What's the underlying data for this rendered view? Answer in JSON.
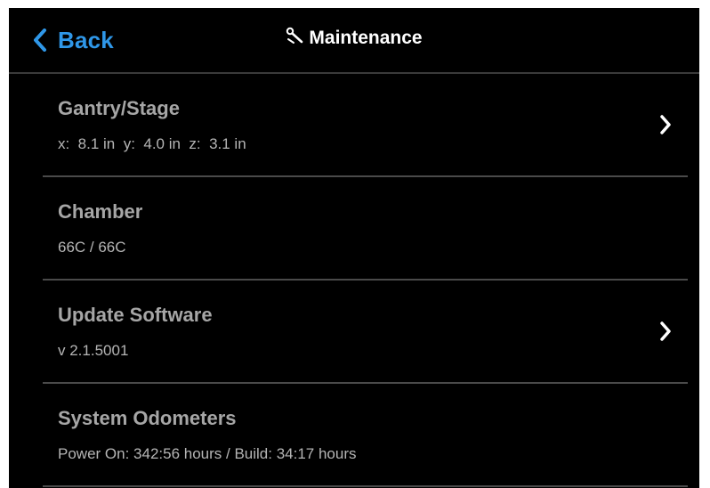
{
  "header": {
    "back_label": "Back",
    "title": "Maintenance",
    "title_icon": "wrench-icon",
    "accent_color": "#2f97e8"
  },
  "rows": [
    {
      "title": "Gantry/Stage",
      "subtitle": "x:  8.1 in  y:  4.0 in  z:  3.1 in",
      "has_chevron": true
    },
    {
      "title": "Chamber",
      "subtitle": "66C / 66C",
      "has_chevron": false
    },
    {
      "title": "Update Software",
      "subtitle": "v 2.1.5001",
      "has_chevron": true
    },
    {
      "title": "System Odometers",
      "subtitle": "Power On: 342:56 hours / Build: 34:17 hours",
      "has_chevron": false
    }
  ]
}
